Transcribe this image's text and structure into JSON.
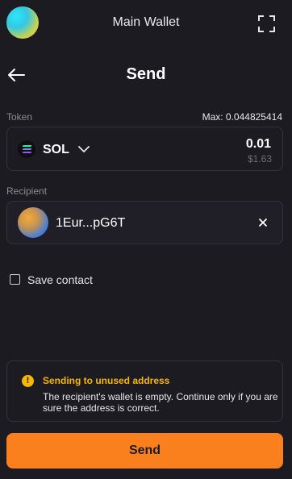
{
  "header": {
    "wallet_title": "Main Wallet",
    "expand_icon": "expand-icon"
  },
  "page": {
    "title": "Send",
    "back_icon": "arrow-left-icon"
  },
  "token": {
    "label": "Token",
    "max_label": "Max: 0.044825414",
    "symbol": "SOL",
    "amount": "0.01",
    "usd_value": "$1.63"
  },
  "recipient": {
    "label": "Recipient",
    "address": "1Eur...pG6T"
  },
  "save_contact": {
    "label": "Save contact",
    "checked": false
  },
  "warning": {
    "title": "Sending to unused address",
    "text": "The recipient's wallet is empty. Continue only if you are sure the address is correct.",
    "color": "#f5b800"
  },
  "actions": {
    "send_label": "Send"
  },
  "colors": {
    "background": "#1c1b22",
    "accent": "#fa7f1d",
    "border": "#33323b"
  }
}
